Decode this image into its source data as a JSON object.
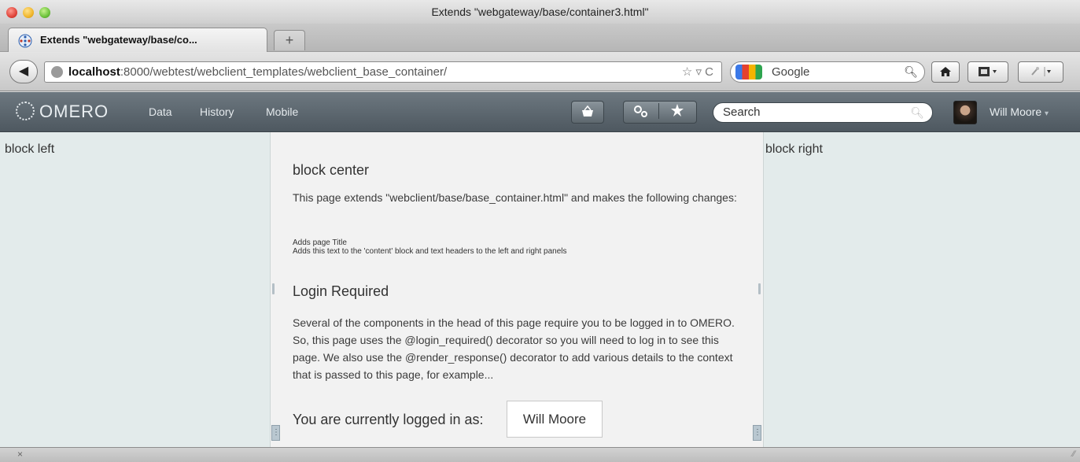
{
  "window": {
    "title": "Extends \"webgateway/base/container3.html\""
  },
  "tabs": {
    "active_label": "Extends \"webgateway/base/co...",
    "new_tab_symbol": "+"
  },
  "addressbar": {
    "back_symbol": "◀",
    "url_host": "localhost",
    "url_rest": ":8000/webtest/webclient_templates/webclient_base_container/",
    "url_tools": "☆ ▿ C",
    "search_placeholder": "Google",
    "search_icon": "magnifier-icon"
  },
  "omero_header": {
    "logo_text": "OMERO",
    "nav_items": [
      "Data",
      "History",
      "Mobile"
    ],
    "search_placeholder": "Search",
    "user_name": "Will Moore",
    "user_menu_caret": "▾"
  },
  "left_panel": {
    "title": "block left"
  },
  "right_panel": {
    "title": "block right"
  },
  "center": {
    "heading": "block center",
    "intro": "This page extends \"webclient/base/base_container.html\" and makes the following changes:",
    "changes": [
      "Adds page Title",
      "Adds this text to the 'content' block and text headers to the left and right panels"
    ],
    "login_heading": "Login Required",
    "login_text": "Several of the components in the head of this page require you to be logged in to OMERO. So, this page uses the @login_required() decorator so you will need to log in to see this page. We also use the @render_response() decorator to add various details to the context that is passed to this page, for example...",
    "logged_in_label": "You are currently logged in as:",
    "logged_in_name": "Will Moore"
  },
  "statusbar": {
    "close_symbol": "×"
  }
}
